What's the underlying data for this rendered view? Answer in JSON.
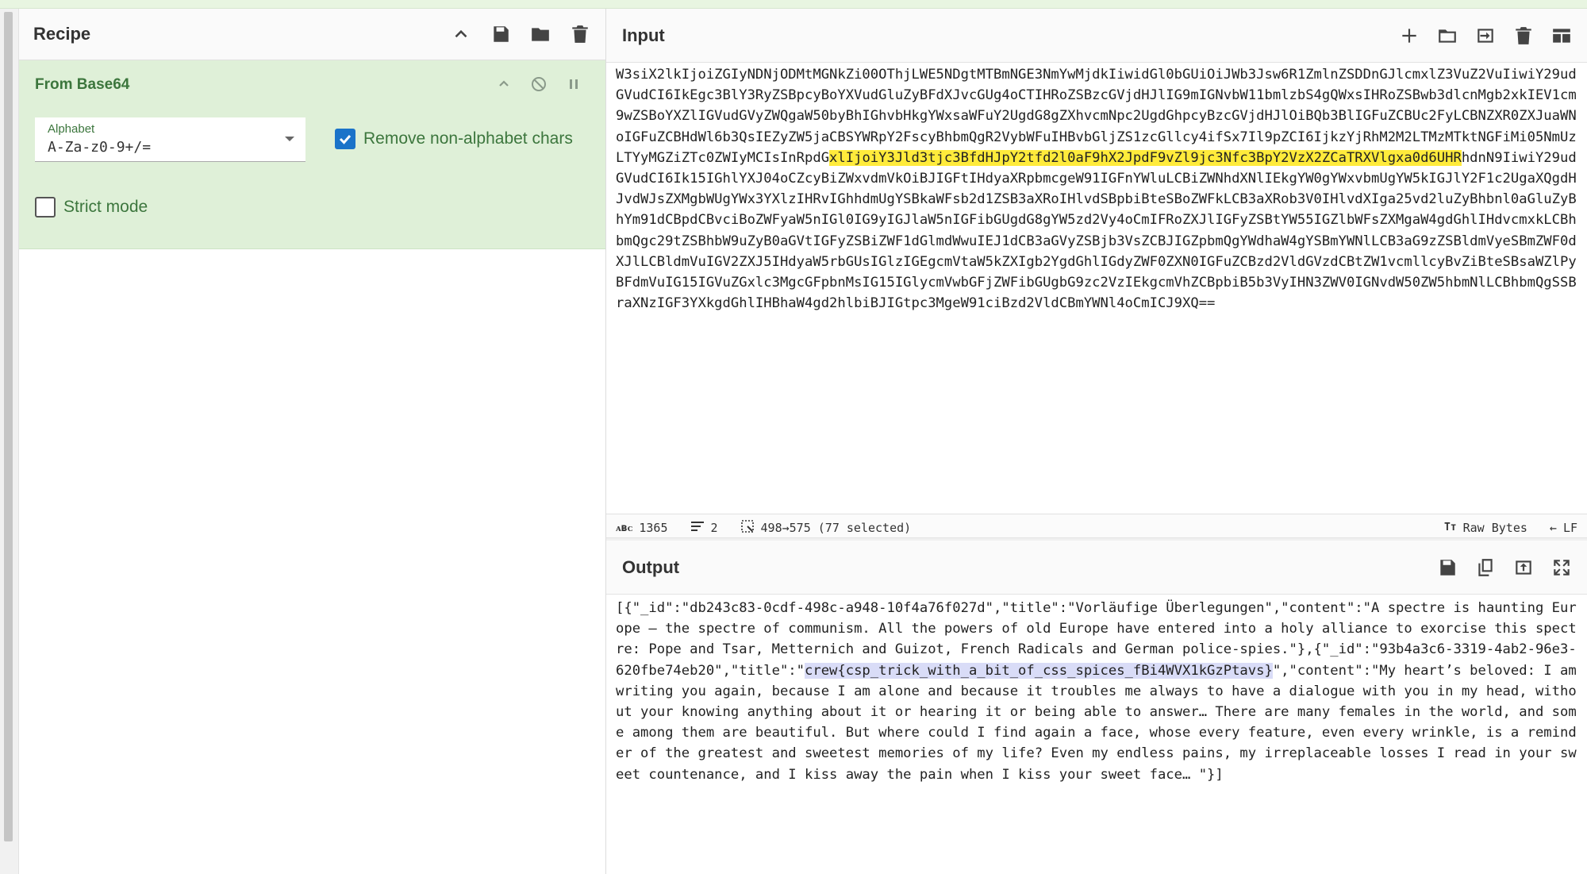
{
  "recipe": {
    "title": "Recipe",
    "operation": {
      "name": "From Base64",
      "alphabet_label": "Alphabet",
      "alphabet_value": "A-Za-z0-9+/=",
      "remove_nonalpha_label": "Remove non-alphabet chars",
      "remove_nonalpha_checked": true,
      "strict_mode_label": "Strict mode",
      "strict_mode_checked": false
    }
  },
  "input": {
    "title": "Input",
    "text_before": "W3siX2lkIjoiZGIyNDNjODMtMGNkZi00OThjLWE5NDgtMTBmNGE3NmYwMjdkIiwidGl0bGUiOiJWb3Jsw6R1ZmlnZSDDnGJlcmxlZ3VuZ2VuIiwiY29udGVudCI6IkEgc3BlY3RyZSBpcyBoYXVudGluZyBFdXJvcGUg4oCTIHRoZSBzcGVjdHJlIG9mIGNvbW11bmlzbS4gQWxsIHRoZSBwb3dlcnMgb2xkIEV1cm9wZSBoYXZlIGVudGVyZWQgaW50byBhIGhvbHkgYWxsaWFuY2UgdG8gZXhvcmNpc2UgdGhpcyBzcGVjdHJlOiBQb3BlIGFuZCBUc2FyLCBNZXR0ZXJuaWNoIGFuZCBHdWl6b3QsIEZyZW5jaCBSYWRpY2FscyBhbmQgR2VybWFuIHBvbGljZS1zcGllcy4ifSx7Il9pZCI6IjkzYjRhM2M2LTMzMTktNGFiMi05NmUzLTYyMGZiZTc0ZWIyMCIsInRpdG",
    "text_highlight": "xlIjoiY3Jld3tjc3BfdHJpY2tfd2l0aF9hX2JpdF9vZl9jc3Nfc3BpY2VzX2ZCaTRXVlgxa0d6UHR",
    "text_after": "hdnN9IiwiY29udGVudCI6Ik15IGhlYXJ04oCZcyBiZWxvdmVkOiBJIGFtIHdyaXRpbmcgeW91IGFnYWluLCBiZWNhdXNlIEkgYW0gYWxvbmUgYW5kIGJlY2F1c2UgaXQgdHJvdWJsZXMgbWUgYWx3YXlzIHRvIGhhdmUgYSBkaWFsb2d1ZSB3aXRoIHlvdSBpbiBteSBoZWFkLCB3aXRob3V0IHlvdXIga25vd2luZyBhbnl0aGluZyBhYm91dCBpdCBvciBoZWFyaW5nIGl0IG9yIGJlaW5nIGFibGUgdG8gYW5zd2Vy4oCmIFRoZXJlIGFyZSBtYW55IGZlbWFsZXMgaW4gdGhlIHdvcmxkLCBhbmQgc29tZSBhbW9uZyB0aGVtIGFyZSBiZWF1dGlmdWwuIEJ1dCB3aGVyZSBjb3VsZCBJIGZpbmQgYWdhaW4gYSBmYWNlLCB3aG9zZSBldmVyeSBmZWF0dXJlLCBldmVuIGV2ZXJ5IHdyaW5rbGUsIGlzIGEgcmVtaW5kZXIgb2YgdGhlIGdyZWF0ZXN0IGFuZCBzd2VldGVzdCBtZW1vcmllcyBvZiBteSBsaWZlPyBFdmVuIG15IGVuZGxlc3MgcGFpbnMsIG15IGlycmVwbGFjZWFibGUgbG9zc2VzIEkgcmVhZCBpbiB5b3VyIHN3ZWV0IGNvdW50ZW5hbmNlLCBhbmQgSSBraXNzIGF3YXkgdGhlIHBhaW4gd2hlbiBJIGtpc3MgeW91ciBzd2VldCBmYWNl4oCmICJ9XQ==",
    "status": {
      "length": "1365",
      "lines": "2",
      "selection": "498→575 (77 selected)",
      "encoding": "Raw Bytes",
      "eol": "LF"
    }
  },
  "output": {
    "title": "Output",
    "text_before": "[{\"_id\":\"db243c83-0cdf-498c-a948-10f4a76f027d\",\"title\":\"Vorläufige Überlegungen\",\"content\":\"A spectre is haunting Europe – the spectre of communism. All the powers of old Europe have entered into a holy alliance to exorcise this spectre: Pope and Tsar, Metternich and Guizot, French Radicals and German police-spies.\"},{\"_id\":\"93b4a3c6-3319-4ab2-96e3-620fbe74eb20\",\"title\":\"",
    "text_highlight": "crew{csp_trick_with_a_bit_of_css_spices_fBi4WVX1kGzPtavs}",
    "text_after": "\",\"content\":\"My heart’s beloved: I am writing you again, because I am alone and because it troubles me always to have a dialogue with you in my head, without your knowing anything about it or hearing it or being able to answer… There are many females in the world, and some among them are beautiful. But where could I find again a face, whose every feature, even every wrinkle, is a reminder of the greatest and sweetest memories of my life? Even my endless pains, my irreplaceable losses I read in your sweet countenance, and I kiss away the pain when I kiss your sweet face… \"}]"
  },
  "colors": {
    "op_bg": "#dff0d8",
    "op_text": "#3c763d",
    "checkbox_blue": "#1a73c9",
    "input_highlight": "#ffeb3b",
    "output_selection": "#d9dcf7"
  }
}
